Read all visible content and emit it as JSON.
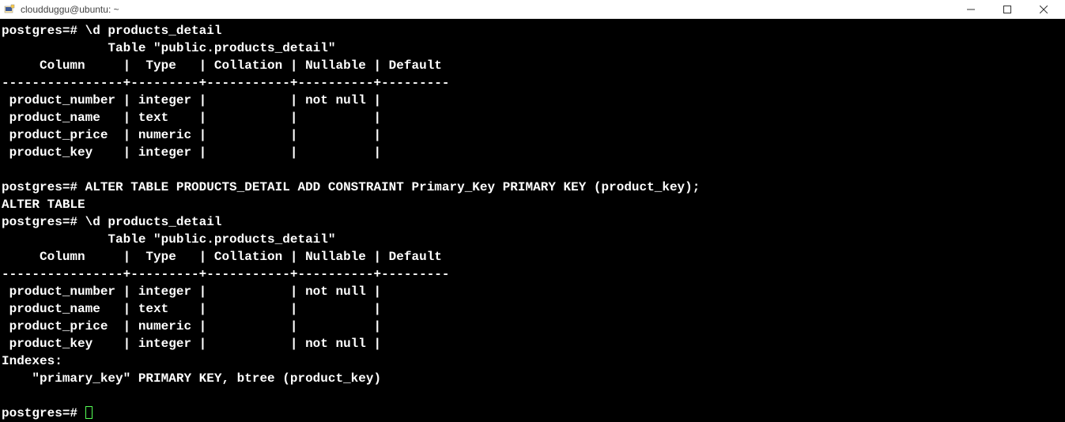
{
  "titlebar": {
    "title": "cloudduggu@ubuntu: ~"
  },
  "terminal": {
    "lines": [
      "postgres=# \\d products_detail",
      "              Table \"public.products_detail\"",
      "     Column     |  Type   | Collation | Nullable | Default",
      "----------------+---------+-----------+----------+---------",
      " product_number | integer |           | not null |",
      " product_name   | text    |           |          |",
      " product_price  | numeric |           |          |",
      " product_key    | integer |           |          |",
      "",
      "postgres=# ALTER TABLE PRODUCTS_DETAIL ADD CONSTRAINT Primary_Key PRIMARY KEY (product_key);",
      "ALTER TABLE",
      "postgres=# \\d products_detail",
      "              Table \"public.products_detail\"",
      "     Column     |  Type   | Collation | Nullable | Default",
      "----------------+---------+-----------+----------+---------",
      " product_number | integer |           | not null |",
      " product_name   | text    |           |          |",
      " product_price  | numeric |           |          |",
      " product_key    | integer |           | not null |",
      "Indexes:",
      "    \"primary_key\" PRIMARY KEY, btree (product_key)",
      "",
      "postgres=# "
    ]
  }
}
